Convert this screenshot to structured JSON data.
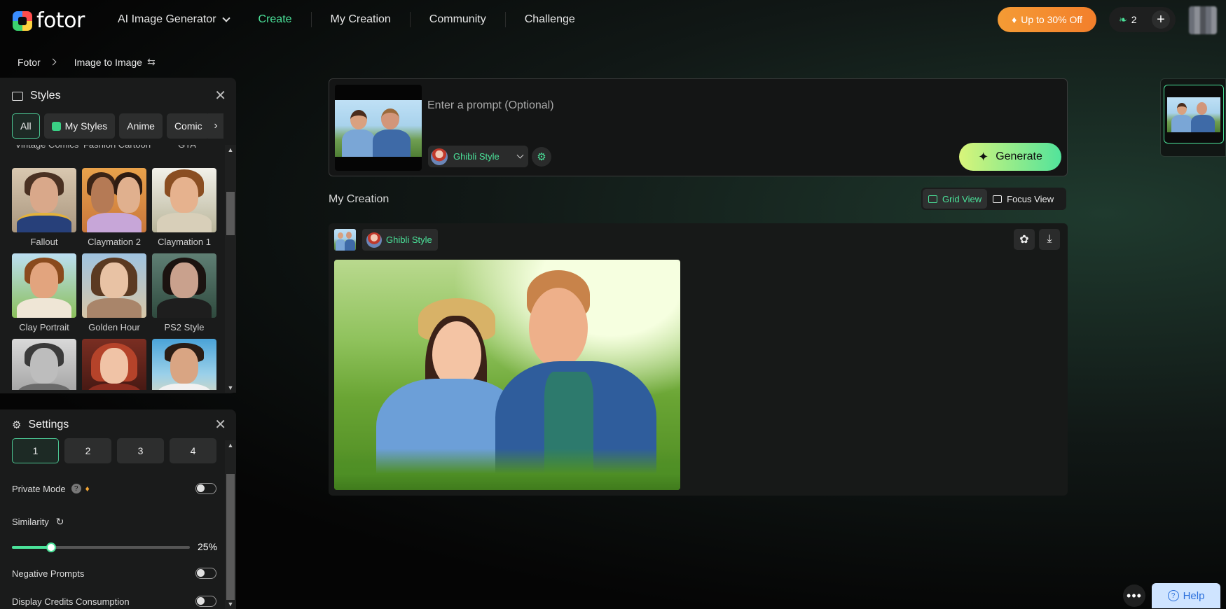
{
  "topnav": {
    "logo_text": "fotor",
    "items": [
      {
        "label": "AI Image Generator"
      },
      {
        "label": "Create"
      },
      {
        "label": "My Creation"
      },
      {
        "label": "Community"
      },
      {
        "label": "Challenge"
      }
    ],
    "promo_label": "Up to 30% Off",
    "credits_count": "2",
    "plus_label": "+",
    "accent_color": "#4be39a"
  },
  "breadcrumb": {
    "root": "Fotor",
    "current": "Image to Image",
    "swap_glyph": "⇆"
  },
  "styles_panel": {
    "title": "Styles",
    "tabs": [
      {
        "label": "All"
      },
      {
        "label": "My Styles"
      },
      {
        "label": "Anime"
      },
      {
        "label": "Comic"
      }
    ],
    "partial_labels": [
      "Vintage Comics",
      "Fashion Cartoon",
      "GTA"
    ],
    "styles": [
      {
        "label": "Fallout"
      },
      {
        "label": "Claymation 2"
      },
      {
        "label": "Claymation 1"
      },
      {
        "label": "Clay Portrait"
      },
      {
        "label": "Golden Hour"
      },
      {
        "label": "PS2 Style"
      },
      {
        "label": ""
      },
      {
        "label": ""
      },
      {
        "label": ""
      }
    ]
  },
  "settings_panel": {
    "title": "Settings",
    "counts": [
      "1",
      "2",
      "3",
      "4"
    ],
    "private_mode_label": "Private Mode",
    "similarity_label": "Similarity",
    "similarity_value": "25%",
    "similarity_fraction": 0.22,
    "negative_prompts_label": "Negative Prompts",
    "display_credits_label": "Display Credits Consumption"
  },
  "prompt": {
    "placeholder": "Enter a prompt (Optional)",
    "selected_style": "Ghibli Style",
    "generate_label": "Generate"
  },
  "creation": {
    "title": "My Creation",
    "grid_view_label": "Grid View",
    "focus_view_label": "Focus View",
    "card_style_label": "Ghibli Style"
  },
  "footer": {
    "more_glyph": "•••",
    "help_label": "Help"
  }
}
